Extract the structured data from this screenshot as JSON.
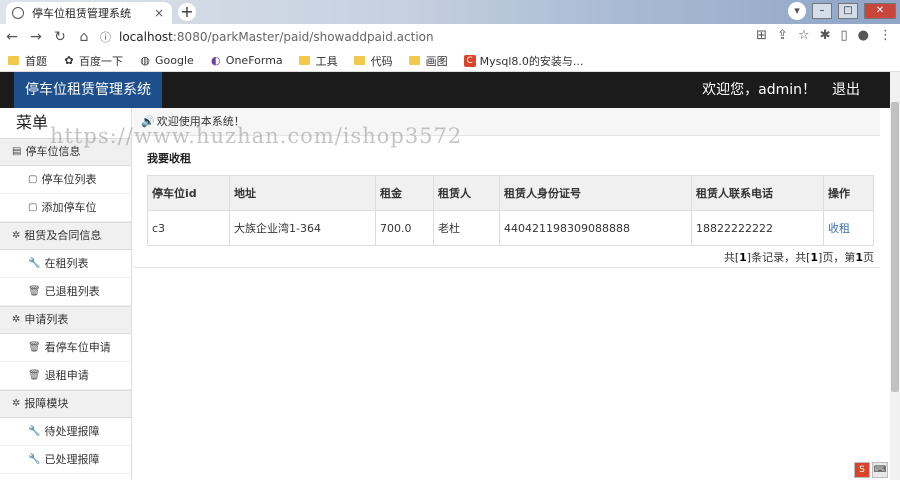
{
  "browser": {
    "tab_title": "停车位租赁管理系统",
    "tab_close": "×",
    "new_tab": "+",
    "url_host": "localhost",
    "url_path": ":8080/parkMaster/paid/showaddpaid.action",
    "bookmarks": [
      {
        "label": "首题",
        "icon": "folder"
      },
      {
        "label": "百度一下",
        "icon": "paw-icon"
      },
      {
        "label": "Google",
        "icon": "globe-icon"
      },
      {
        "label": "OneForma",
        "icon": "oneforma-icon"
      },
      {
        "label": "工具",
        "icon": "folder"
      },
      {
        "label": "代码",
        "icon": "folder"
      },
      {
        "label": "画图",
        "icon": "folder"
      },
      {
        "label": "Mysql8.0的安装与...",
        "icon": "c-icon"
      }
    ]
  },
  "header": {
    "brand": "停车位租赁管理系统",
    "welcome": "欢迎您，admin！",
    "logout": "退出"
  },
  "sidebar": {
    "title": "菜单",
    "groups": [
      {
        "label": "停车位信息",
        "icon": "list-icon",
        "items": [
          "停车位列表",
          "添加停车位"
        ]
      },
      {
        "label": "租赁及合同信息",
        "icon": "gear-icon",
        "items": [
          "在租列表",
          "已退租列表"
        ]
      },
      {
        "label": "申请列表",
        "icon": "gear-icon",
        "items": [
          "看停车位申请",
          "退租申请"
        ]
      },
      {
        "label": "报障模块",
        "icon": "gear-icon",
        "items": [
          "待处理报障",
          "已处理报障"
        ]
      }
    ]
  },
  "content": {
    "notice": "欢迎使用本系统！",
    "section_title": "我要收租",
    "columns": [
      "停车位id",
      "地址",
      "租金",
      "租赁人",
      "租赁人身份证号",
      "租赁人联系电话",
      "操作"
    ],
    "rows": [
      {
        "id": "c3",
        "address": "大族企业湾1-364",
        "rent": "700.0",
        "tenant": "老杜",
        "id_card": "440421198309088888",
        "phone": "18822222222",
        "action": "收租"
      }
    ],
    "pager": {
      "p1": "共[",
      "total_records": "1",
      "p2": "]条记录，共[",
      "total_pages": "1",
      "p3": "]页，第",
      "current_page": "1",
      "p4": "页"
    }
  },
  "watermark": "https://www.huzhan.com/ishop3572",
  "colors": {
    "brand_bg": "#1e4f8d",
    "header_bg": "#1b1b1b",
    "link": "#3a6fb2"
  }
}
